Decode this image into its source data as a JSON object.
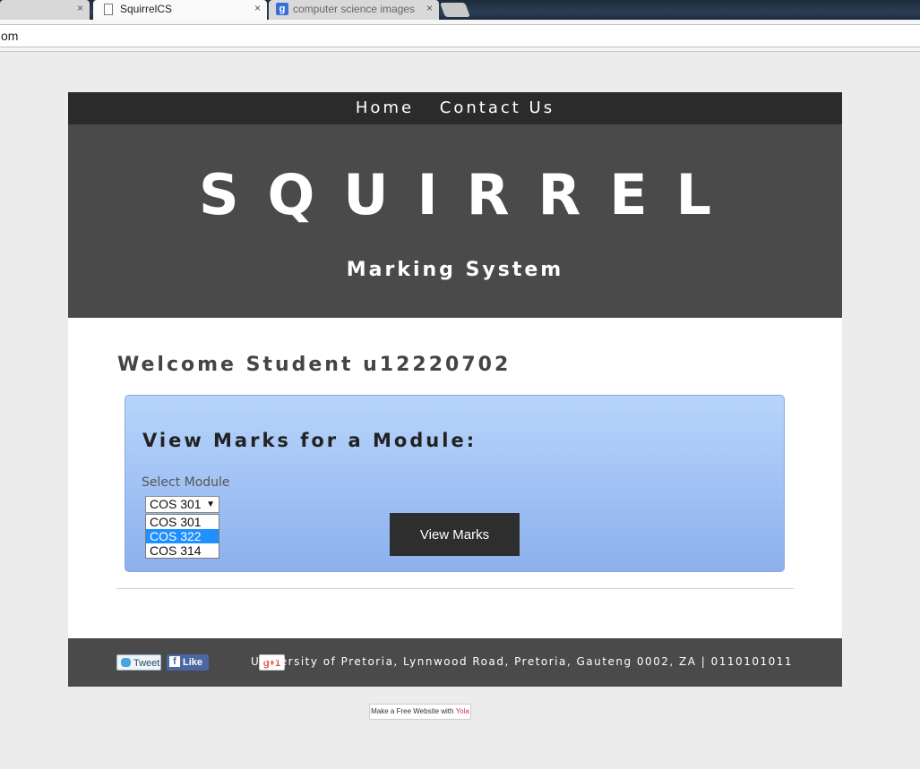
{
  "browser": {
    "tabs": [
      {
        "title": "",
        "close": "×"
      },
      {
        "title": "SquirrelCS",
        "close": "×"
      },
      {
        "title": "computer science images",
        "close": "×"
      }
    ],
    "address": "om"
  },
  "nav": {
    "items": [
      "Home",
      "Contact Us"
    ]
  },
  "header": {
    "logo": "SQUIRREL",
    "tagline": "Marking System"
  },
  "content": {
    "welcome": "Welcome Student u12220702",
    "panel": {
      "title": "View Marks for a Module:",
      "select_label": "Select Module",
      "selected_value": "COS 301",
      "options": [
        "COS 301",
        "COS 322",
        "COS 314"
      ],
      "highlighted_option": "COS 322",
      "button_label": "View Marks"
    }
  },
  "footer": {
    "social": {
      "tweet": "Tweet",
      "like": "Like",
      "gplus": "g+1"
    },
    "address": "University of Pretoria, Lynnwood Road, Pretoria, Gauteng 0002, ZA | 0110101011"
  },
  "badge": {
    "prefix": "Make a Free Website with ",
    "brand": "Yola"
  },
  "colors": {
    "nav_bg": "#2b2b2b",
    "header_bg": "#4a4a4a",
    "panel_top": "#b7d5fb",
    "panel_bottom": "#8db0ee",
    "highlight": "#1e90ff"
  },
  "icons": [
    "document-icon",
    "google-icon",
    "twitter-icon",
    "facebook-icon",
    "google-plus-icon",
    "dropdown-arrow-icon"
  ]
}
